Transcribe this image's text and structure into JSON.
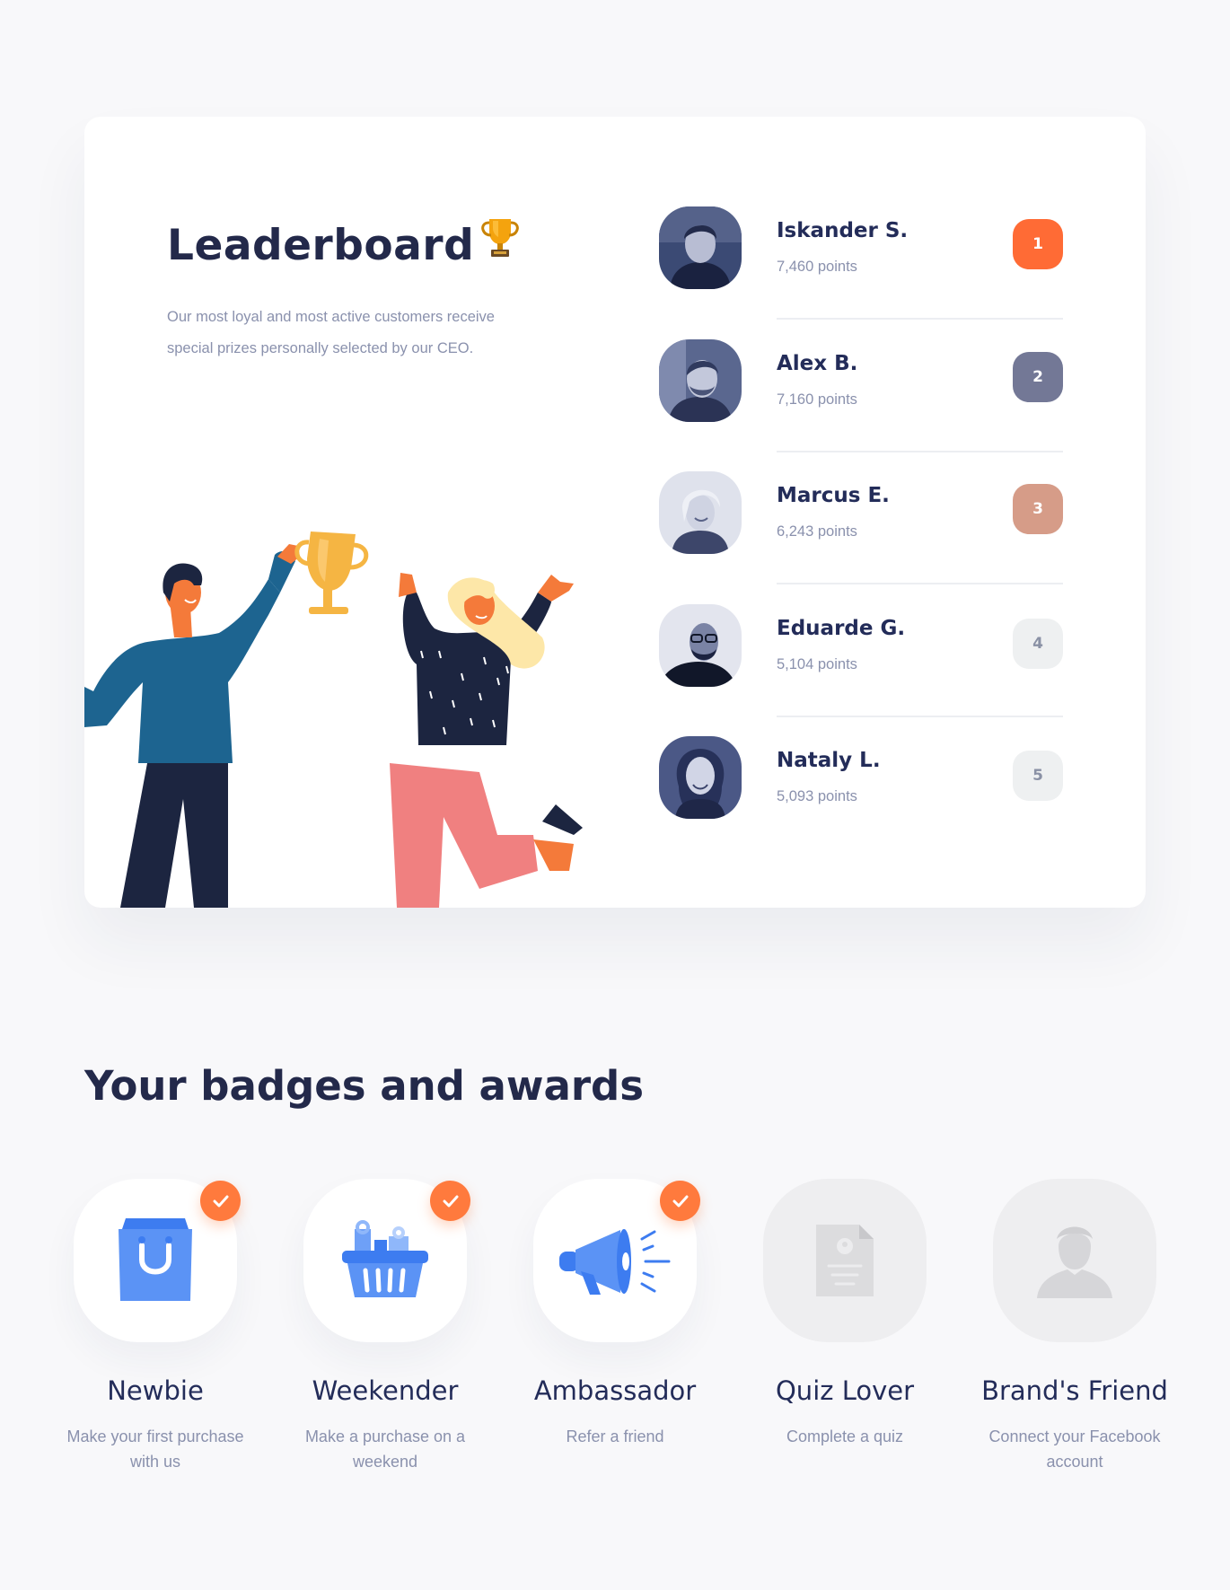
{
  "leaderboard": {
    "title": "Leaderboard",
    "description": "Our most loyal and most active customers receive special prizes personally selected by our CEO.",
    "entries": [
      {
        "name": "Iskander S.",
        "points": "7,460 points",
        "rank": "1",
        "rank_color": "#ff6b35"
      },
      {
        "name": "Alex B.",
        "points": "7,160 points",
        "rank": "2",
        "rank_color": "#737896"
      },
      {
        "name": "Marcus E.",
        "points": "6,243 points",
        "rank": "3",
        "rank_color": "#d69c88"
      },
      {
        "name": "Eduarde G.",
        "points": "5,104 points",
        "rank": "4",
        "rank_color": "#eef0f1"
      },
      {
        "name": "Nataly L.",
        "points": "5,093 points",
        "rank": "5",
        "rank_color": "#eef0f1"
      }
    ]
  },
  "badges": {
    "title": "Your badges and awards",
    "items": [
      {
        "name": "Newbie",
        "description": "Make your first purchase with us",
        "icon": "shopping-bag-icon",
        "earned": true
      },
      {
        "name": "Weekender",
        "description": "Make a purchase on a weekend",
        "icon": "gift-basket-icon",
        "earned": true
      },
      {
        "name": "Ambassador",
        "description": "Refer a friend",
        "icon": "megaphone-icon",
        "earned": true
      },
      {
        "name": "Quiz Lover",
        "description": "Complete a quiz",
        "icon": "document-icon",
        "earned": false
      },
      {
        "name": "Brand's Friend",
        "description": "Connect your Facebook account",
        "icon": "user-silhouette-icon",
        "earned": false
      }
    ]
  },
  "colors": {
    "accent": "#ff7a3d",
    "badge_blue": "#3d7cf0",
    "heading": "#23294a",
    "muted_text": "#8a91ad"
  }
}
